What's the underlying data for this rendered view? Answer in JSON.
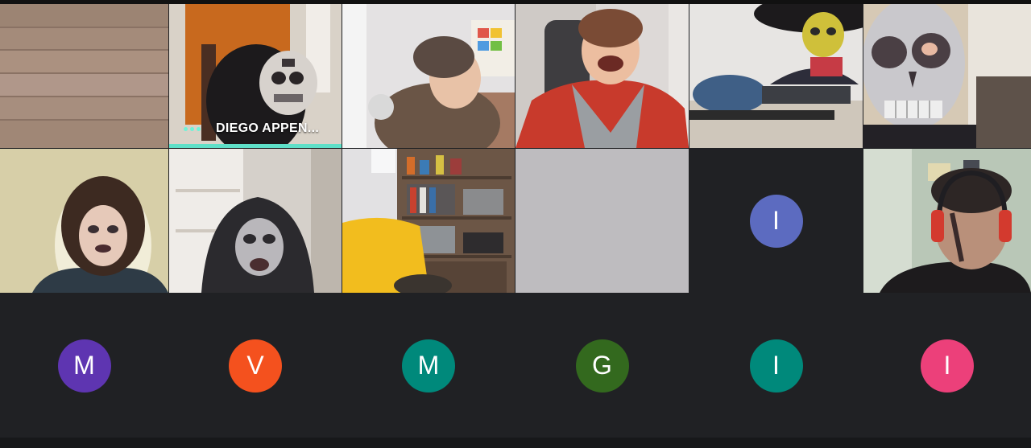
{
  "meeting": {
    "tiles": [
      {
        "kind": "video",
        "scene": "wooden-wall"
      },
      {
        "kind": "video",
        "scene": "skeleton-mask-speaker",
        "name": "DIEGO APPEN...",
        "speaking": true
      },
      {
        "kind": "video",
        "scene": "boy-brown-hoodie"
      },
      {
        "kind": "video",
        "scene": "boy-red-jacket-laughing"
      },
      {
        "kind": "video",
        "scene": "sombrero-face-paint"
      },
      {
        "kind": "video",
        "scene": "skeleton-mask-closeup"
      },
      {
        "kind": "video",
        "scene": "girl-face-paint"
      },
      {
        "kind": "video",
        "scene": "hooded-costume"
      },
      {
        "kind": "video",
        "scene": "bookshelf-chair"
      },
      {
        "kind": "video",
        "scene": "blank-gray"
      },
      {
        "kind": "avatar",
        "initial": "I",
        "color": "#5c6bc0"
      },
      {
        "kind": "video",
        "scene": "boy-red-headphones"
      },
      {
        "kind": "avatar",
        "initial": "M",
        "color": "#5e35b1"
      },
      {
        "kind": "avatar",
        "initial": "V",
        "color": "#f4511e"
      },
      {
        "kind": "avatar",
        "initial": "M",
        "color": "#00897b"
      },
      {
        "kind": "avatar",
        "initial": "G",
        "color": "#33691e"
      },
      {
        "kind": "avatar",
        "initial": "I",
        "color": "#00897b"
      },
      {
        "kind": "avatar",
        "initial": "I",
        "color": "#ec407a"
      }
    ]
  }
}
